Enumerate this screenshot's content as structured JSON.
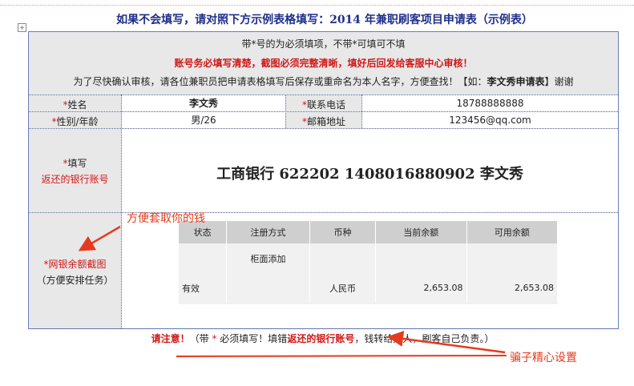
{
  "title": "如果不会填写，请对照下方示例表格填写：2014 年兼职刷客项目申请表（示例表）",
  "notes": {
    "line1": "带*号的为必须填项，不带*可填可不填",
    "line2": "账号务必填写清楚，截图必须完整清晰，填好后回发给客服中心审核！",
    "line3_prefix": "为了尽快确认审核，请各位兼职员把申请表格填写后保存或重命名为本人名字，方便查找！【如：",
    "line3_example": "李文秀申请表",
    "line3_suffix": "】谢谢"
  },
  "star": "*",
  "fields": {
    "name_label": "姓名",
    "name_value": "李文秀",
    "phone_label": "联系电话",
    "phone_value": "18788888888",
    "gender_label": "性别/年龄",
    "gender_value": "男/26",
    "email_label": "邮箱地址",
    "email_value": "123456@qq.com"
  },
  "bank": {
    "label_line1": "填写",
    "label_line2": "返还的银行账号",
    "value": "工商银行 622202 1408016880902 李文秀"
  },
  "screenshot": {
    "label_line1": "网银余额截图",
    "label_line2": "（方便安排任务）",
    "headers": [
      "状态",
      "注册方式",
      "币种",
      "当前余额",
      "可用余额"
    ],
    "rows": [
      [
        "",
        "柜面添加",
        "",
        "",
        ""
      ],
      [
        "有效",
        "",
        "人民币",
        "2,653.08",
        "2,653.08"
      ]
    ]
  },
  "footer": {
    "attention": "请注意！",
    "text1": "（带 ",
    "text2": " 必须填写！填错",
    "highlight": "返还的银行账号",
    "text3": "，钱转给别人，刷客自己负责。）"
  },
  "annotations": {
    "top": "方便套取你的钱",
    "bottom": "骗子精心设置"
  },
  "colors": {
    "title": "#1f2f8a",
    "required": "#d01818",
    "annotation": "#e53b1d",
    "table_bg": "#e8e8e8",
    "border": "#6b7fb8"
  }
}
